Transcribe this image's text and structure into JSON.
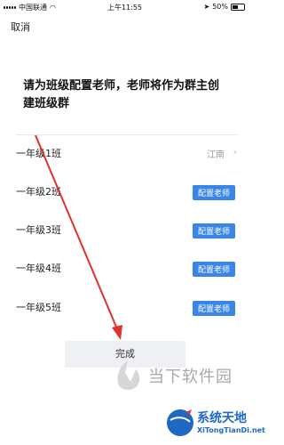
{
  "status_bar": {
    "carrier": "中国联通",
    "time": "上午11:55",
    "battery": "50%"
  },
  "header": {
    "cancel_label": "取消"
  },
  "title": "请为班级配置老师，老师将作为群主创建班级群",
  "classes": [
    {
      "name": "一年级1班",
      "teacher": "江南",
      "action": ""
    },
    {
      "name": "一年级2班",
      "teacher": "",
      "action": "配置老师"
    },
    {
      "name": "一年级3班",
      "teacher": "",
      "action": "配置老师"
    },
    {
      "name": "一年级4班",
      "teacher": "",
      "action": "配置老师"
    },
    {
      "name": "一年级5班",
      "teacher": "",
      "action": "配置老师"
    }
  ],
  "done_label": "完成",
  "watermark": {
    "top": "当下软件园",
    "bottom_cn": "系统天地",
    "bottom_en": "XiTongTianDi.net"
  },
  "colors": {
    "accent": "#3a86e8",
    "arrow": "#e0312b",
    "watermark_blue": "#1f68c3"
  }
}
